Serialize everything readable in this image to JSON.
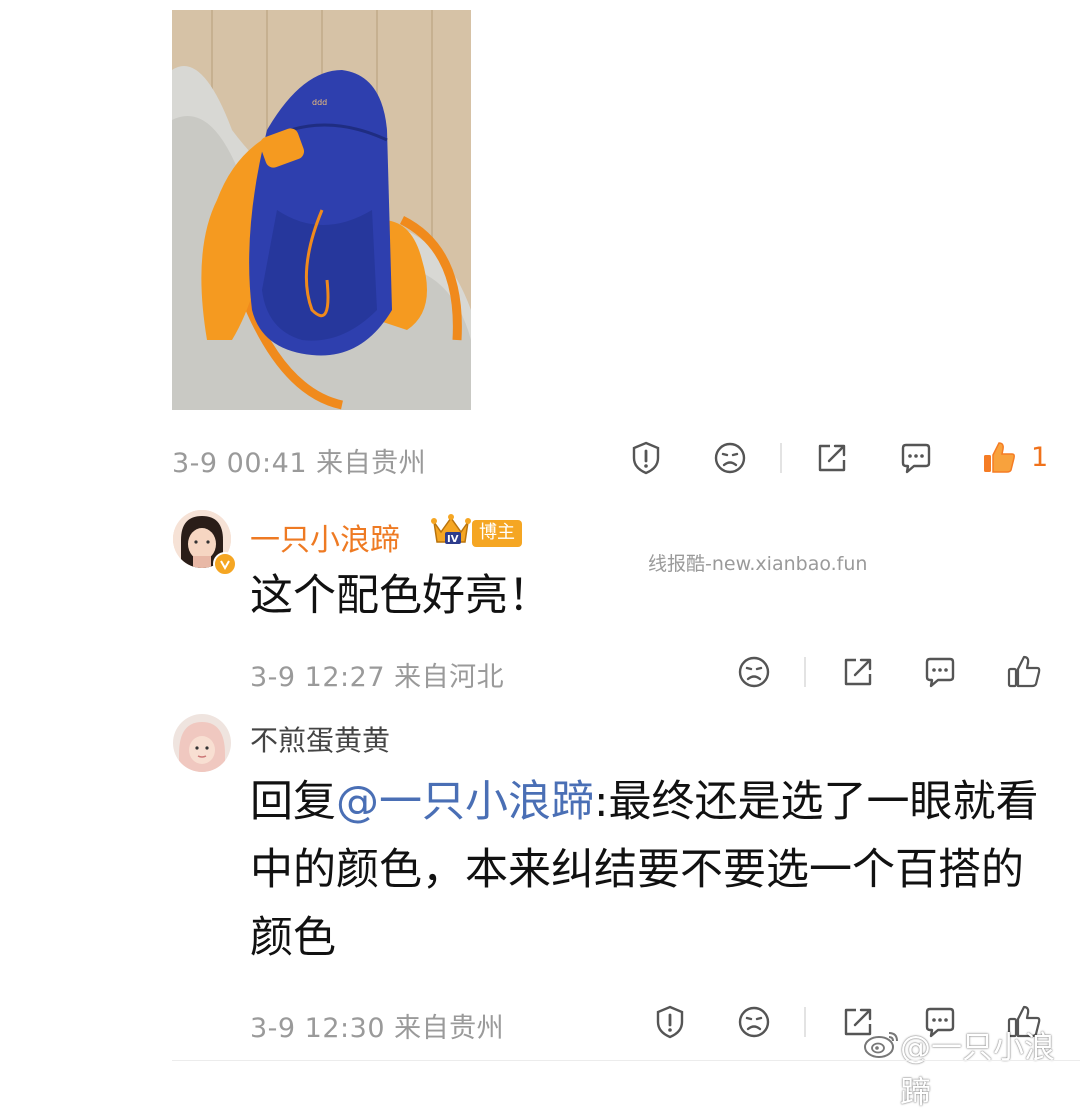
{
  "post": {
    "meta": "3-9 00:41 来自贵州",
    "like_count": "1"
  },
  "comment1": {
    "username": "一只小浪蹄",
    "badge": "博主",
    "text": "这个配色好亮！",
    "meta": "3-9 12:27 来自河北"
  },
  "comment2": {
    "username": "不煎蛋黄黄",
    "reply_prefix": "回复",
    "mention": "@一只小浪蹄",
    "text": ":最终还是选了一眼就看中的颜色，本来纠结要不要选一个百搭的颜色",
    "meta": "3-9 12:30 来自贵州"
  },
  "watermark_site": "线报酷-new.xianbao.fun",
  "watermark_weibo": "@一只小浪蹄",
  "colors": {
    "accent": "#ee7a23",
    "mention": "#4a6fb5",
    "meta": "#9a9a9a"
  }
}
